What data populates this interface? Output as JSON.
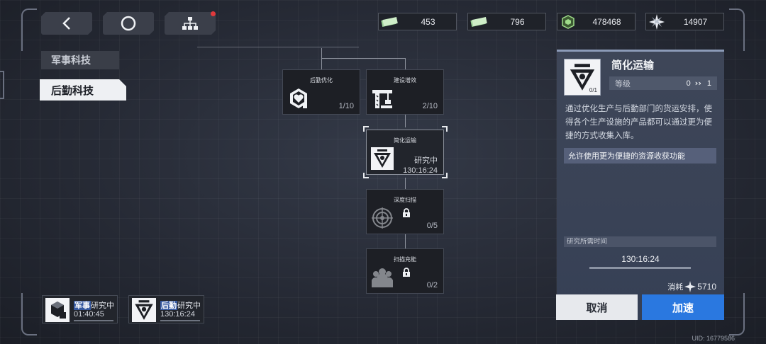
{
  "currencies": [
    {
      "icon": "cash-bundle-icon",
      "value": "453"
    },
    {
      "icon": "cash-bundle-icon",
      "value": "796"
    },
    {
      "icon": "resource-crystal-icon",
      "value": "478468"
    },
    {
      "icon": "star-shard-icon",
      "value": "14907"
    }
  ],
  "categories": {
    "military": "军事科技",
    "logistics": "后勤科技"
  },
  "tree": {
    "nodes": [
      {
        "title": "后勤优化",
        "progress": "1/10",
        "icon": "hex-heart-icon",
        "locked": false
      },
      {
        "title": "建设增效",
        "progress": "2/10",
        "icon": "crane-icon",
        "locked": false
      },
      {
        "title": "简化运输",
        "status": "研究中",
        "timer": "130:16:24",
        "icon": "transport-emblem-icon",
        "selected": true
      },
      {
        "title": "深度扫描",
        "progress": "0/5",
        "icon": "scan-radar-icon",
        "locked": true
      },
      {
        "title": "扫描充能",
        "progress": "0/2",
        "icon": "soldier-group-icon",
        "locked": true
      }
    ]
  },
  "panel": {
    "title": "简化运输",
    "count": "0/1",
    "level_label": "等级",
    "level_from": "0",
    "level_to": "1",
    "description": "通过优化生产与后勤部门的货运安排，使得各个生产设施的产品都可以通过更为便捷的方式收集入库。",
    "effect": "允许使用更为便捷的资源收获功能",
    "time_label": "研究所需时间",
    "time": "130:16:24",
    "cost_label": "消耗",
    "cost_value": "5710"
  },
  "buttons": {
    "cancel": "取消",
    "speed_up": "加速"
  },
  "research_slots": [
    {
      "category": "军事",
      "status": "研究中",
      "timer": "01:40:45"
    },
    {
      "category": "后勤",
      "status": "研究中",
      "timer": "130:16:24"
    }
  ],
  "uid": "UID: 16779586",
  "colors": {
    "accent_blue": "#2a78e0",
    "notification": "#e0393c",
    "panel_bg": "#3e4658"
  }
}
